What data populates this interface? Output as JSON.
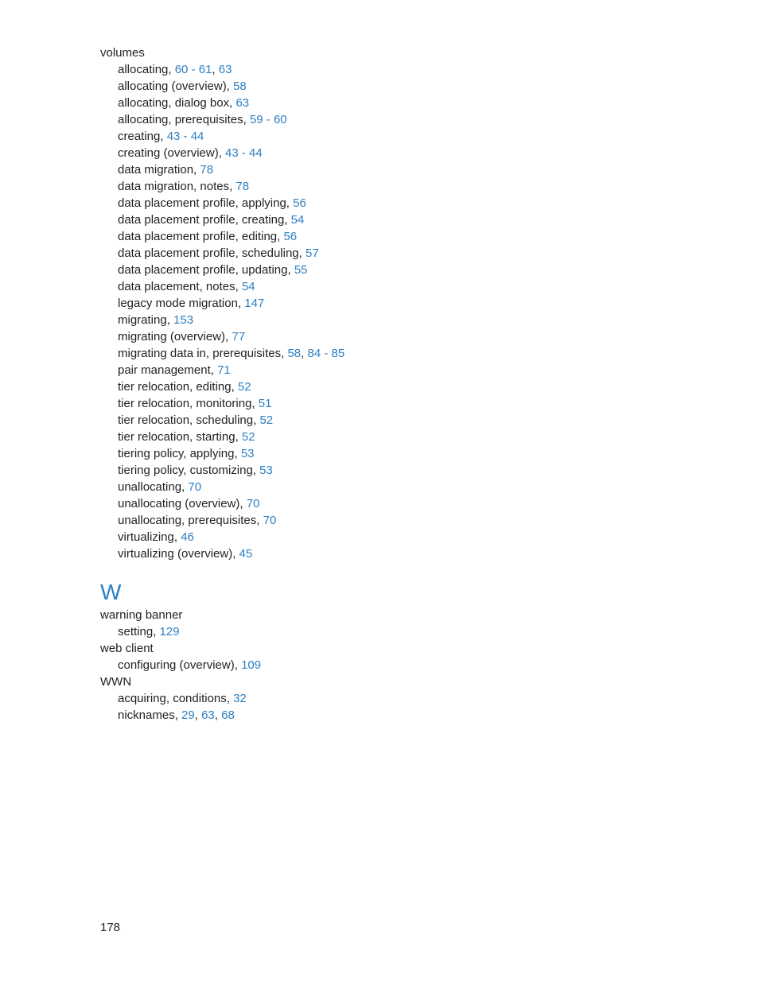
{
  "page_number": "178",
  "section_v": {
    "term": "volumes",
    "items": [
      {
        "text": "allocating, ",
        "refs": [
          "60 - 61",
          "63"
        ]
      },
      {
        "text": "allocating (overview), ",
        "refs": [
          "58"
        ]
      },
      {
        "text": "allocating, dialog box, ",
        "refs": [
          "63"
        ]
      },
      {
        "text": "allocating, prerequisites, ",
        "refs": [
          "59 - 60"
        ]
      },
      {
        "text": "creating, ",
        "refs": [
          "43 - 44"
        ]
      },
      {
        "text": "creating (overview), ",
        "refs": [
          "43 - 44"
        ]
      },
      {
        "text": "data migration, ",
        "refs": [
          "78"
        ]
      },
      {
        "text": "data migration, notes, ",
        "refs": [
          "78"
        ]
      },
      {
        "text": "data placement profile, applying, ",
        "refs": [
          "56"
        ]
      },
      {
        "text": "data placement profile, creating, ",
        "refs": [
          "54"
        ]
      },
      {
        "text": "data placement profile, editing, ",
        "refs": [
          "56"
        ]
      },
      {
        "text": "data placement profile, scheduling, ",
        "refs": [
          "57"
        ]
      },
      {
        "text": "data placement profile, updating, ",
        "refs": [
          "55"
        ]
      },
      {
        "text": "data placement, notes, ",
        "refs": [
          "54"
        ]
      },
      {
        "text": "legacy mode migration, ",
        "refs": [
          "147"
        ]
      },
      {
        "text": "migrating, ",
        "refs": [
          "153"
        ]
      },
      {
        "text": "migrating (overview), ",
        "refs": [
          "77"
        ]
      },
      {
        "text": "migrating data in, prerequisites, ",
        "refs": [
          "58",
          "84 - 85"
        ]
      },
      {
        "text": "pair management, ",
        "refs": [
          "71"
        ]
      },
      {
        "text": "tier relocation, editing, ",
        "refs": [
          "52"
        ]
      },
      {
        "text": "tier relocation, monitoring, ",
        "refs": [
          "51"
        ]
      },
      {
        "text": "tier relocation, scheduling, ",
        "refs": [
          "52"
        ]
      },
      {
        "text": "tier relocation, starting, ",
        "refs": [
          "52"
        ]
      },
      {
        "text": "tiering policy, applying, ",
        "refs": [
          "53"
        ]
      },
      {
        "text": "tiering policy, customizing, ",
        "refs": [
          "53"
        ]
      },
      {
        "text": "unallocating, ",
        "refs": [
          "70"
        ]
      },
      {
        "text": "unallocating (overview), ",
        "refs": [
          "70"
        ]
      },
      {
        "text": "unallocating, prerequisites, ",
        "refs": [
          "70"
        ]
      },
      {
        "text": "virtualizing, ",
        "refs": [
          "46"
        ]
      },
      {
        "text": "virtualizing (overview), ",
        "refs": [
          "45"
        ]
      }
    ]
  },
  "section_w": {
    "heading": "W",
    "groups": [
      {
        "term": "warning banner",
        "items": [
          {
            "text": "setting, ",
            "refs": [
              "129"
            ]
          }
        ]
      },
      {
        "term": "web client",
        "items": [
          {
            "text": "configuring (overview), ",
            "refs": [
              "109"
            ]
          }
        ]
      },
      {
        "term": "WWN",
        "items": [
          {
            "text": "acquiring, conditions, ",
            "refs": [
              "32"
            ]
          },
          {
            "text": "nicknames, ",
            "refs": [
              "29",
              "63",
              "68"
            ]
          }
        ]
      }
    ]
  }
}
